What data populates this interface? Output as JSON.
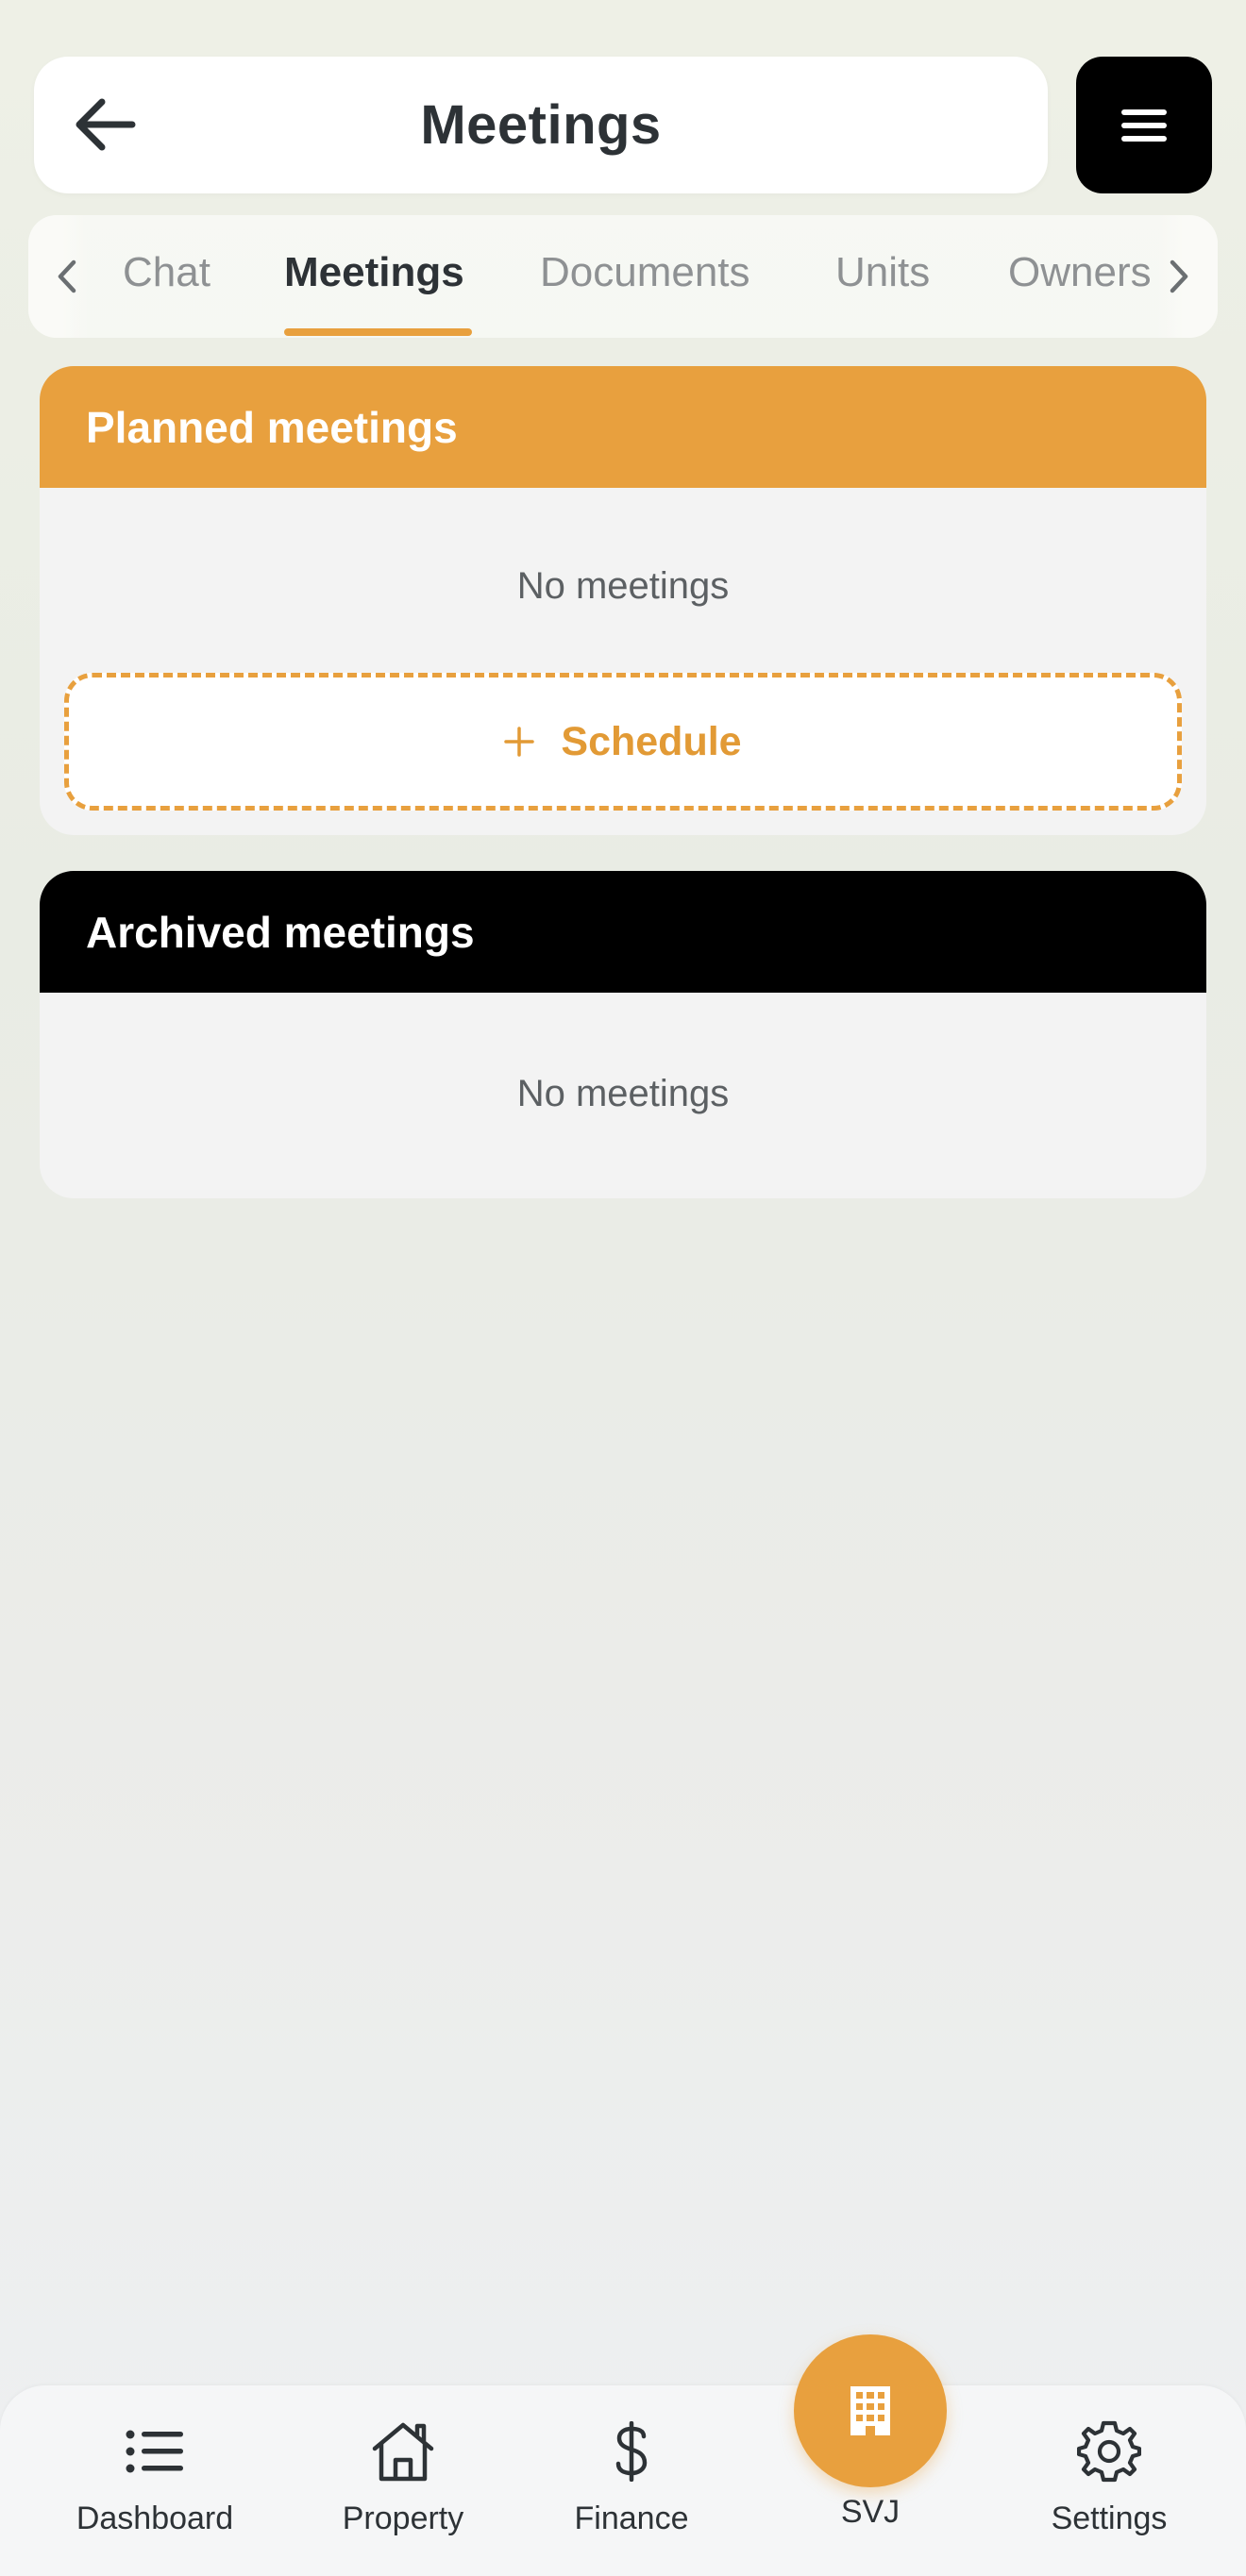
{
  "header": {
    "title": "Meetings"
  },
  "tabs": [
    {
      "label": "Chat",
      "active": false
    },
    {
      "label": "Meetings",
      "active": true
    },
    {
      "label": "Documents",
      "active": false
    },
    {
      "label": "Units",
      "active": false
    },
    {
      "label": "Owners",
      "active": false
    }
  ],
  "tabs_partial_left": "s",
  "planned": {
    "title": "Planned meetings",
    "empty_text": "No meetings",
    "schedule_label": "Schedule"
  },
  "archived": {
    "title": "Archived meetings",
    "empty_text": "No meetings"
  },
  "bottom_nav": {
    "items": [
      {
        "label": "Dashboard",
        "icon": "list-icon"
      },
      {
        "label": "Property",
        "icon": "home-icon"
      },
      {
        "label": "Finance",
        "icon": "dollar-icon"
      },
      {
        "label": "SVJ",
        "icon": "building-icon"
      },
      {
        "label": "Settings",
        "icon": "gear-icon"
      }
    ]
  },
  "colors": {
    "accent": "#e8a03e",
    "dark": "#000000",
    "text": "#2d3236",
    "muted": "#8e9193",
    "card_bg": "#f3f3f3"
  }
}
